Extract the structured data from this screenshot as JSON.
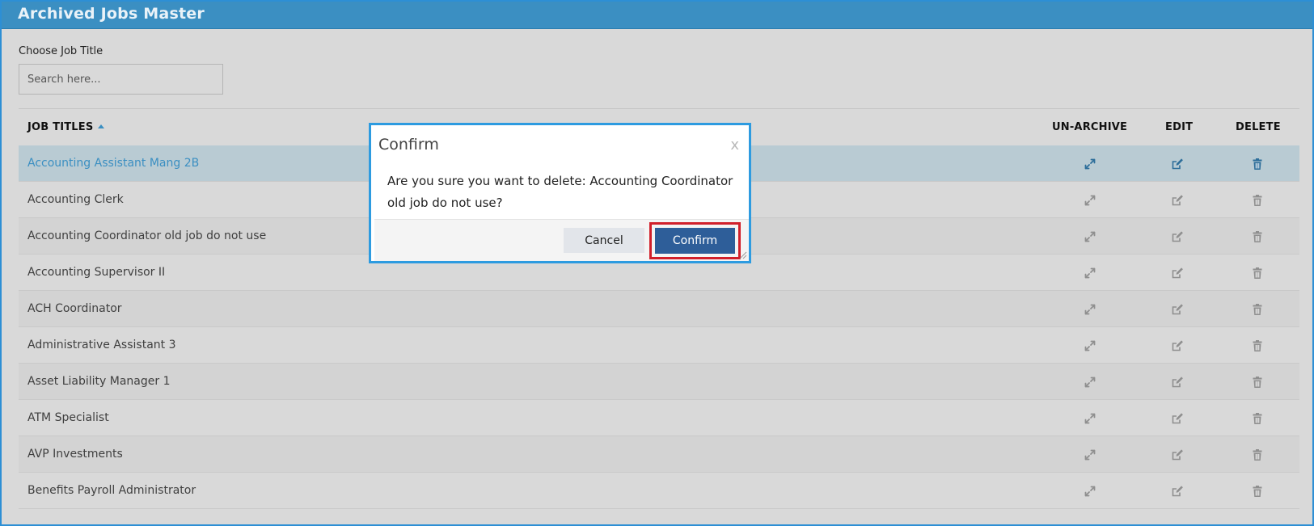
{
  "page": {
    "title": "Archived Jobs Master"
  },
  "filter": {
    "label": "Choose Job Title",
    "placeholder": "Search here..."
  },
  "table": {
    "columns": {
      "title": "JOB TITLES",
      "unarchive": "UN-ARCHIVE",
      "edit": "EDIT",
      "delete": "DELETE"
    },
    "sort": "ascending",
    "rows": [
      {
        "name": "Accounting Assistant Mang 2B",
        "selected": true
      },
      {
        "name": "Accounting Clerk",
        "selected": false
      },
      {
        "name": "Accounting Coordinator old job do not use",
        "selected": false
      },
      {
        "name": "Accounting Supervisor II",
        "selected": false
      },
      {
        "name": "ACH Coordinator",
        "selected": false
      },
      {
        "name": "Administrative Assistant 3",
        "selected": false
      },
      {
        "name": "Asset Liability Manager 1",
        "selected": false
      },
      {
        "name": "ATM Specialist",
        "selected": false
      },
      {
        "name": "AVP Investments",
        "selected": false
      },
      {
        "name": "Benefits Payroll Administrator",
        "selected": false
      }
    ],
    "row_icons": [
      "expand-icon",
      "edit-icon",
      "trash-icon"
    ]
  },
  "modal": {
    "title": "Confirm",
    "close": "x",
    "message": "Are you sure you want to delete: Accounting Coordinator old job do not use?",
    "cancel_label": "Cancel",
    "confirm_label": "Confirm"
  },
  "colors": {
    "header": "#3b8fc2",
    "selected_row": "#b9cbd3",
    "confirm_button": "#2e5e99",
    "highlight_outline": "#d11f2a",
    "modal_border": "#2d9be0"
  }
}
